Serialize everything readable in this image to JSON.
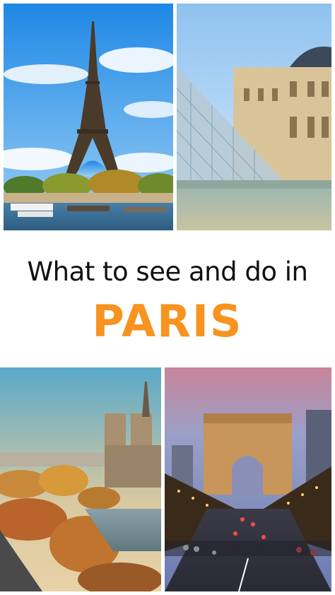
{
  "headline": {
    "line1": "What to see and do in",
    "line2": "PARIS",
    "line2_color": "#f7931e"
  },
  "photos": [
    {
      "subject": "eiffel-tower"
    },
    {
      "subject": "louvre-pyramid"
    },
    {
      "subject": "notre-dame-seine-autumn"
    },
    {
      "subject": "arc-de-triomphe-champs-elysees-night"
    }
  ]
}
